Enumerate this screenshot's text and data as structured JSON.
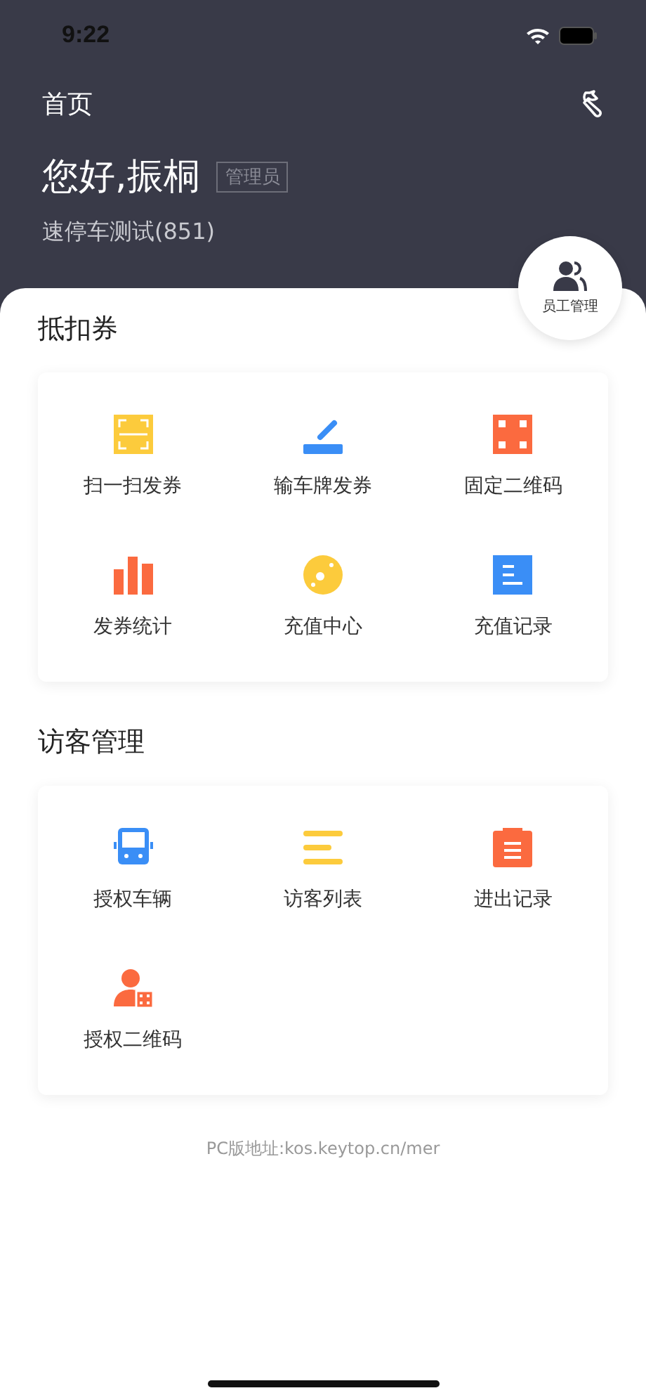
{
  "status_bar": {
    "time": "9:22"
  },
  "header": {
    "title": "首页",
    "greeting": "您好,振桐",
    "role": "管理员",
    "company": "速停车测试(851)"
  },
  "float_button": {
    "label": "员工管理"
  },
  "sections": [
    {
      "title": "抵扣券",
      "items": [
        {
          "label": "扫一扫发券",
          "kind": "scan",
          "color": "#fccb3c"
        },
        {
          "label": "输车牌发券",
          "kind": "pen",
          "color": "#3a8ef6"
        },
        {
          "label": "固定二维码",
          "kind": "qr",
          "color": "#fb6a3f"
        },
        {
          "label": "发券统计",
          "kind": "bars",
          "color": "#fb6a3f"
        },
        {
          "label": "充值中心",
          "kind": "disc",
          "color": "#fccb3c"
        },
        {
          "label": "充值记录",
          "kind": "doc",
          "color": "#3a8ef6"
        }
      ]
    },
    {
      "title": "访客管理",
      "items": [
        {
          "label": "授权车辆",
          "kind": "bus",
          "color": "#3a8ef6"
        },
        {
          "label": "访客列表",
          "kind": "lines",
          "color": "#fccb3c"
        },
        {
          "label": "进出记录",
          "kind": "clipboard",
          "color": "#fb6a3f"
        },
        {
          "label": "授权二维码",
          "kind": "person",
          "color": "#fb6a3f"
        }
      ]
    }
  ],
  "footer": "PC版地址:kos.keytop.cn/mer"
}
